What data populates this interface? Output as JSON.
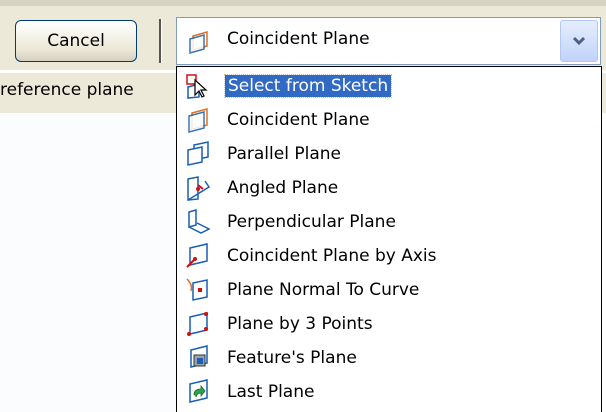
{
  "toolbar": {
    "cancel_label": "Cancel",
    "combo": {
      "value": "Coincident Plane",
      "icon": "coincident-plane-icon"
    }
  },
  "status": {
    "text": "reference plane"
  },
  "dropdown": {
    "items": [
      {
        "label": "Select from Sketch",
        "icon": "select-from-sketch-icon",
        "selected": true
      },
      {
        "label": "Coincident Plane",
        "icon": "coincident-plane-icon"
      },
      {
        "label": "Parallel Plane",
        "icon": "parallel-plane-icon"
      },
      {
        "label": "Angled Plane",
        "icon": "angled-plane-icon"
      },
      {
        "label": "Perpendicular Plane",
        "icon": "perpendicular-plane-icon"
      },
      {
        "label": "Coincident Plane by Axis",
        "icon": "coincident-plane-by-axis-icon"
      },
      {
        "label": "Plane Normal To Curve",
        "icon": "plane-normal-to-curve-icon"
      },
      {
        "label": "Plane by 3 Points",
        "icon": "plane-by-3-points-icon"
      },
      {
        "label": "Feature's Plane",
        "icon": "features-plane-icon"
      },
      {
        "label": "Last Plane",
        "icon": "last-plane-icon"
      }
    ]
  },
  "colors": {
    "selection": "#316ac5",
    "toolbar": "#ece9d8",
    "icon_blue": "#1a5fb4",
    "icon_red": "#d01010",
    "icon_orange": "#e07020"
  }
}
